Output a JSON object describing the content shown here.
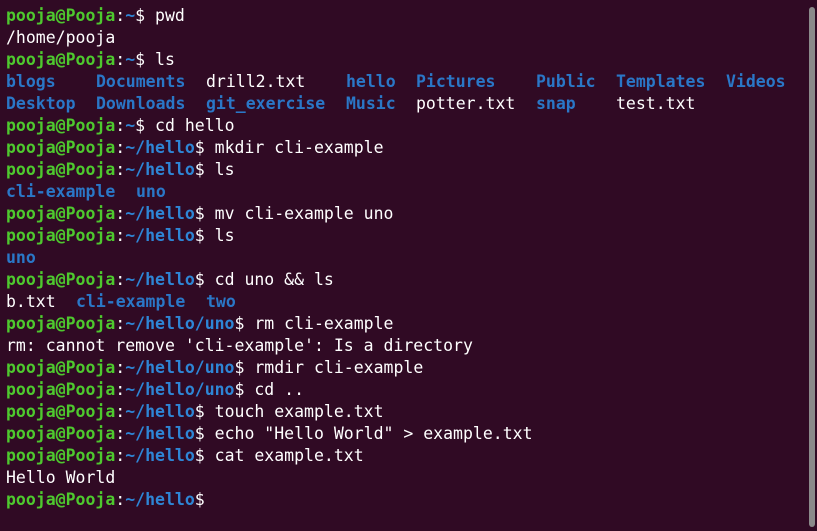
{
  "prompt_user": "pooja@Pooja",
  "lines": [
    {
      "path": "~",
      "cmd": " pwd"
    },
    {
      "output": "/home/pooja"
    },
    {
      "path": "~",
      "cmd": " ls"
    },
    {
      "listing": [
        "blogs",
        "Documents",
        "drill2.txt",
        "hello",
        "Pictures",
        "Public",
        "Templates",
        "Videos"
      ]
    },
    {
      "listing2": [
        "Desktop",
        "Downloads",
        "git_exercise",
        "Music",
        "potter.txt",
        "snap",
        "test.txt"
      ]
    },
    {
      "path": "~",
      "cmd": " cd hello"
    },
    {
      "path": "~/hello",
      "cmd": " mkdir cli-example"
    },
    {
      "path": "~/hello",
      "cmd": " ls"
    },
    {
      "listing3": [
        "cli-example",
        "uno"
      ]
    },
    {
      "path": "~/hello",
      "cmd": " mv cli-example uno"
    },
    {
      "path": "~/hello",
      "cmd": " ls"
    },
    {
      "listing4": [
        "uno"
      ]
    },
    {
      "path": "~/hello",
      "cmd": " cd uno && ls"
    },
    {
      "listing5": [
        "b.txt",
        "cli-example",
        "two"
      ]
    },
    {
      "path": "~/hello/uno",
      "cmd": " rm cli-example"
    },
    {
      "output": "rm: cannot remove 'cli-example': Is a directory"
    },
    {
      "path": "~/hello/uno",
      "cmd": " rmdir cli-example"
    },
    {
      "path": "~/hello/uno",
      "cmd": " cd .."
    },
    {
      "path": "~/hello",
      "cmd": " touch example.txt"
    },
    {
      "path": "~/hello",
      "cmd": " echo \"Hello World\" > example.txt"
    },
    {
      "path": "~/hello",
      "cmd": " cat example.txt"
    },
    {
      "output": "Hello World"
    },
    {
      "path": "~/hello",
      "cmd": ""
    }
  ],
  "colors": {
    "background": "#300a24",
    "user": "#4ec92e",
    "path": "#2e86d6",
    "directory": "#2a77c7",
    "text": "#ffffff"
  }
}
